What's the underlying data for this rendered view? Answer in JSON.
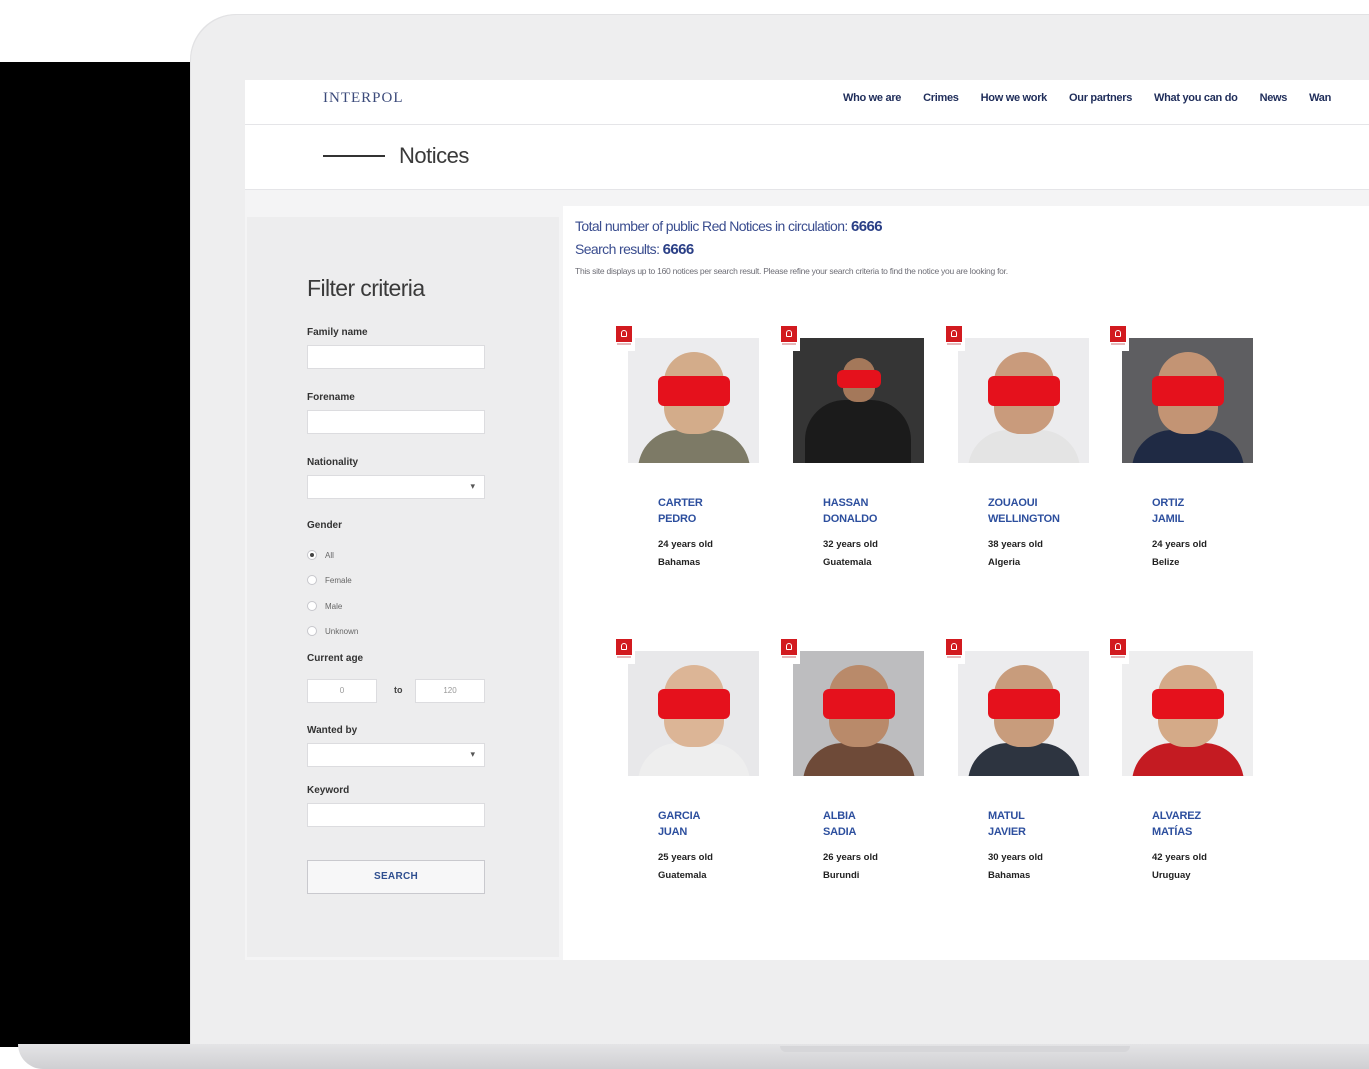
{
  "header": {
    "logo": "INTERPOL",
    "nav": [
      "Who we are",
      "Crimes",
      "How we work",
      "Our partners",
      "What you can do",
      "News",
      "Wan"
    ]
  },
  "page": {
    "title": "Notices"
  },
  "filter": {
    "title": "Filter criteria",
    "family_name_label": "Family name",
    "forename_label": "Forename",
    "nationality_label": "Nationality",
    "gender_label": "Gender",
    "gender_options": [
      "All",
      "Female",
      "Male",
      "Unknown"
    ],
    "gender_selected": "All",
    "current_age_label": "Current age",
    "age_from": "0",
    "age_to_label": "to",
    "age_to": "120",
    "wanted_by_label": "Wanted by",
    "keyword_label": "Keyword",
    "search_button": "SEARCH"
  },
  "results": {
    "total_label": "Total number of public Red Notices in circulation:",
    "total_value": "6666",
    "search_label": "Search results:",
    "search_value": "6666",
    "disclaimer": "This site displays up to 160 notices per search result. Please refine your search criteria to find the notice you are looking for."
  },
  "notices": [
    {
      "family": "CARTER",
      "forename": "PEDRO",
      "age": "24 years old",
      "nationality": "Bahamas",
      "skin": "#d3ac8a",
      "shirt": "#7d7a66",
      "bg": "#ececee"
    },
    {
      "family": "HASSAN",
      "forename": "DONALDO",
      "age": "32 years old",
      "nationality": "Guatemala",
      "skin": "#a4785a",
      "shirt": "#1b1b1b",
      "bg": "#353535"
    },
    {
      "family": "ZOUAOUI",
      "forename": "WELLINGTON",
      "age": "38 years old",
      "nationality": "Algeria",
      "skin": "#c99b7c",
      "shirt": "#e4e4e4",
      "bg": "#ececee"
    },
    {
      "family": "ORTIZ",
      "forename": "JAMIL",
      "age": "24 years old",
      "nationality": "Belize",
      "skin": "#c39474",
      "shirt": "#1f2a44",
      "bg": "#5e5e61"
    },
    {
      "family": "GARCIA",
      "forename": "JUAN",
      "age": "25 years old",
      "nationality": "Guatemala",
      "skin": "#dcb596",
      "shirt": "#eeeeee",
      "bg": "#e8e8ea"
    },
    {
      "family": "ALBIA",
      "forename": "SADIA",
      "age": "26 years old",
      "nationality": "Burundi",
      "skin": "#b98a6a",
      "shirt": "#6e4a38",
      "bg": "#bdbdbf"
    },
    {
      "family": "MATUL",
      "forename": "JAVIER",
      "age": "30 years old",
      "nationality": "Bahamas",
      "skin": "#c89c7c",
      "shirt": "#2d3440",
      "bg": "#ececee"
    },
    {
      "family": "ALVAREZ",
      "forename": "MATÍAS",
      "age": "42 years old",
      "nationality": "Uruguay",
      "skin": "#d4aa88",
      "shirt": "#c41b22",
      "bg": "#eeeeef"
    }
  ]
}
